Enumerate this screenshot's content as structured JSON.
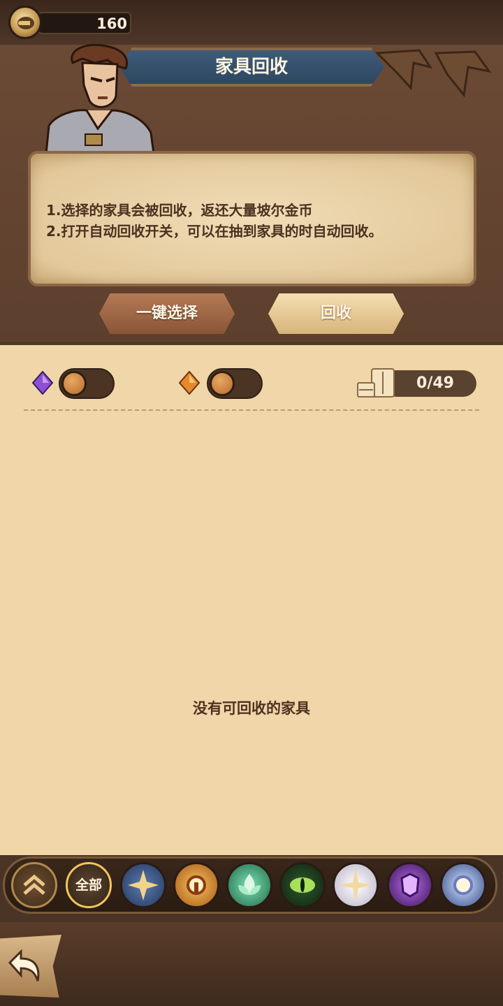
{
  "currency": {
    "icon": "gold-coin-icon",
    "amount": "160"
  },
  "header": {
    "title": "家具回收"
  },
  "info": {
    "lines": [
      "1.选择的家具会被回收，返还大量坡尔金币",
      "2.打开自动回收开关，可以在抽到家具的时自动回收。"
    ]
  },
  "buttons": {
    "select_all": "一键选择",
    "recycle": "回收"
  },
  "toggles": [
    {
      "gem": "purple-gem-icon",
      "enabled": false
    },
    {
      "gem": "orange-gem-icon",
      "enabled": false
    }
  ],
  "capacity": {
    "icon": "furniture-cabinet-icon",
    "count": "0/49"
  },
  "empty_message": "没有可回收的家具",
  "filters": {
    "rarity_icon": "chevron-up-double-icon",
    "all_label": "全部",
    "factions": [
      "compass-star-faction-icon",
      "sun-faction-icon",
      "lotus-faction-icon",
      "eye-faction-icon",
      "radiant-star-faction-icon",
      "demon-faction-icon",
      "orb-faction-icon"
    ]
  },
  "colors": {
    "parchment": "#f0d6a8",
    "wood_dark": "#4a3426",
    "banner_blue": "#3f5b78",
    "text_brown": "#4a3120"
  }
}
